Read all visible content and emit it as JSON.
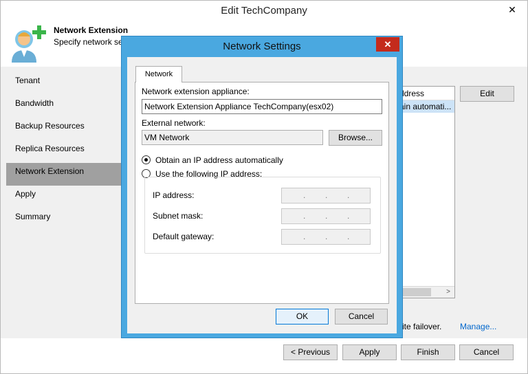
{
  "outer": {
    "title": "Edit TechCompany",
    "close_glyph": "✕",
    "header_title": "Network Extension",
    "header_subtitle": "Specify network se",
    "icon": "user-add-icon",
    "nav": [
      "Tenant",
      "Bandwidth",
      "Backup Resources",
      "Replica Resources",
      "Network Extension",
      "Apply",
      "Summary"
    ],
    "active_nav": "Network Extension",
    "list": {
      "header": "ddress",
      "row": "ain automati..."
    },
    "edit_label": "Edit",
    "failover_text": "site failover.",
    "manage_label": "Manage...",
    "footer_buttons": {
      "previous": "< Previous",
      "apply": "Apply",
      "finish": "Finish",
      "cancel": "Cancel"
    }
  },
  "modal": {
    "title": "Network Settings",
    "close_glyph": "✕",
    "tab": "Network",
    "appliance_label": "Network extension appliance:",
    "appliance_value": "Network Extension Appliance TechCompany(esx02)",
    "external_label": "External network:",
    "external_value": "VM Network",
    "browse_label": "Browse...",
    "radio_auto": "Obtain an IP address automatically",
    "radio_manual": "Use the following IP address:",
    "ip_label": "IP address:",
    "subnet_label": "Subnet mask:",
    "gateway_label": "Default gateway:",
    "ok_label": "OK",
    "cancel_label": "Cancel"
  },
  "colors": {
    "modal_frame": "#4aa8e0",
    "close_red": "#c42b1c",
    "selected_row": "#cde3f7",
    "link": "#0066cc"
  }
}
